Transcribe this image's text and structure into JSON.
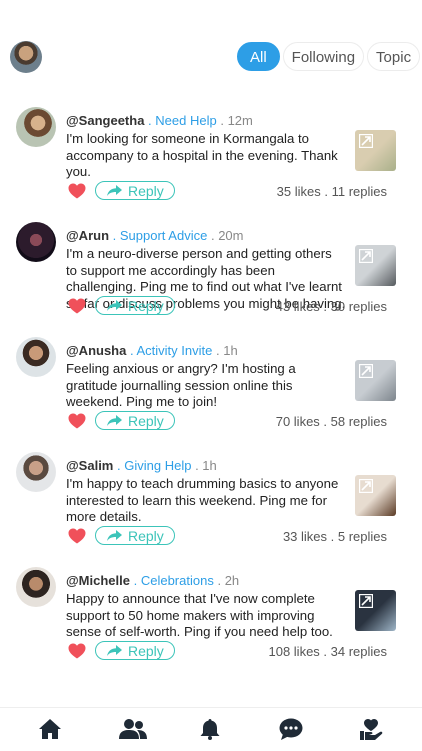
{
  "header": {
    "tabs": [
      {
        "label": "All",
        "active": true
      },
      {
        "label": "Following",
        "active": false
      },
      {
        "label": "Topic",
        "active": false
      }
    ]
  },
  "posts": [
    {
      "handle": "@Sangeetha",
      "category": "Need Help",
      "time": "12m",
      "text": "I'm looking for someone in Kormangala to accompany to a hospital in the evening. Thank you.",
      "reply_label": "Reply",
      "stats": "35 likes . 11 replies",
      "thumb_colors": [
        "#d9cdb0",
        "#a9b08a"
      ]
    },
    {
      "handle": "@Arun",
      "category": "Support Advice",
      "time": "20m",
      "text": "I'm a neuro-diverse person and getting others to support me accordingly has been challenging. Ping me to find out what I've learnt so far or discuss problems you might be having.",
      "reply_label": "Reply",
      "stats": "43 likes . 30 replies",
      "thumb_colors": [
        "#cfd3d6",
        "#555a5e"
      ]
    },
    {
      "handle": "@Anusha",
      "category": "Activity Invite",
      "time": "1h",
      "text": "Feeling anxious or angry? I'm hosting a gratitude journalling session online this weekend. Ping me to join!",
      "reply_label": "Reply",
      "stats": "70 likes . 58 replies",
      "thumb_colors": [
        "#c7ccd1",
        "#7d858c"
      ]
    },
    {
      "handle": "@Salim",
      "category": "Giving Help",
      "time": "1h",
      "text": "I'm happy to teach drumming basics to anyone interested to learn this weekend. Ping me for more details.",
      "reply_label": "Reply",
      "stats": "33 likes . 5 replies",
      "thumb_colors": [
        "#e7dcd0",
        "#5a3a25"
      ]
    },
    {
      "handle": "@Michelle",
      "category": "Celebrations",
      "time": "2h",
      "text": "Happy to announce that I've now complete support to 50 home makers with improving sense of self-worth. Ping if you need help too.",
      "reply_label": "Reply",
      "stats": "108 likes . 34 replies",
      "thumb_colors": [
        "#2a3340",
        "#9fb6c8"
      ]
    }
  ],
  "nav": {
    "items": [
      "home-icon",
      "people-icon",
      "bell-icon",
      "chat-icon",
      "heart-hand-icon"
    ]
  },
  "colors": {
    "accent": "#2d9ee6",
    "reply": "#3cc4b9",
    "heart": "#f0505a"
  }
}
